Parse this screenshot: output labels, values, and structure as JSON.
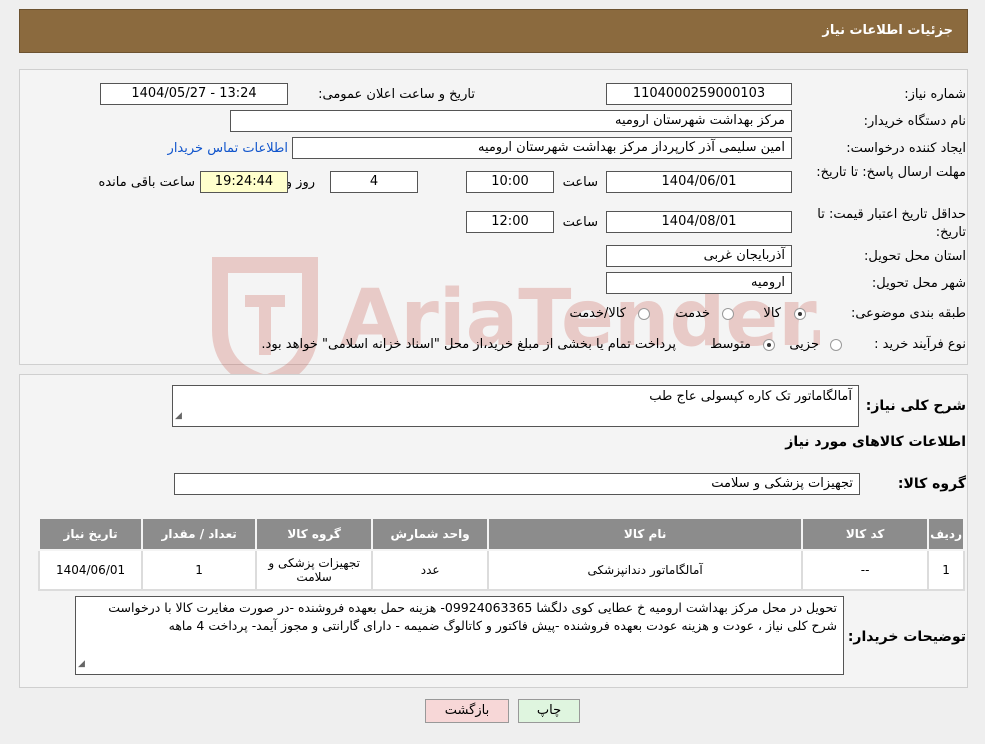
{
  "header": {
    "title": "جزئیات اطلاعات نیاز"
  },
  "watermark": {
    "text": "AriaTender.neT"
  },
  "form": {
    "need_number_label": "شماره نیاز:",
    "need_number": "1104000259000103",
    "announce_label": "تاریخ و ساعت اعلان عمومی:",
    "announce_value": "1404/05/27 - 13:24",
    "buyer_org_label": "نام دستگاه خریدار:",
    "buyer_org": "مرکز بهداشت شهرستان ارومیه",
    "creator_label": "ایجاد کننده درخواست:",
    "creator": "امین سلیمی آذر کارپرداز مرکز بهداشت شهرستان ارومیه",
    "contact_link": "اطلاعات تماس خریدار",
    "deadline_label": "مهلت ارسال پاسخ: تا تاریخ:",
    "deadline_date": "1404/06/01",
    "time_label": "ساعت",
    "deadline_time": "10:00",
    "days_value": "4",
    "days_label": "روز و",
    "remaining_time": "19:24:44",
    "remaining_label": "ساعت باقی مانده",
    "validity_label": "حداقل تاریخ اعتبار قیمت: تا تاریخ:",
    "validity_date": "1404/08/01",
    "validity_time": "12:00",
    "province_label": "استان محل تحویل:",
    "province": "آذربایجان غربی",
    "city_label": "شهر محل تحویل:",
    "city": "ارومیه",
    "category_label": "طبقه بندی موضوعی:",
    "category_options": [
      "کالا",
      "خدمت",
      "کالا/خدمت"
    ],
    "category_selected": 0,
    "purchase_label": "نوع فرآیند خرید :",
    "purchase_options": [
      "جزیی",
      "متوسط"
    ],
    "purchase_selected": 1,
    "purchase_note": "پرداخت تمام یا بخشی از مبلغ خرید،از محل \"اسناد خزانه اسلامی\" خواهد بود."
  },
  "details": {
    "summary_label": "شرح کلی نیاز:",
    "summary": "آمالگاماتور تک کاره کپسولی عاج طب",
    "goods_info_title": "اطلاعات کالاهای مورد نیاز",
    "goods_group_label": "گروه کالا:",
    "goods_group": "تجهیزات پزشکی و سلامت",
    "table": {
      "headers": [
        "ردیف",
        "کد کالا",
        "نام کالا",
        "واحد شمارش",
        "گروه کالا",
        "تعداد / مقدار",
        "تاریخ نیاز"
      ],
      "rows": [
        [
          "1",
          "--",
          "آمالگاماتور دندانپزشکی",
          "عدد",
          "تجهیزات پزشکی و سلامت",
          "1",
          "1404/06/01"
        ]
      ]
    },
    "buyer_notes_label": "توضیحات خریدار:",
    "buyer_notes": "تحویل در محل مرکز بهداشت ارومیه خ عطایی کوی دلگشا 09924063365- هزینه حمل بعهده فروشنده -در صورت مغایرت کالا با درخواست شرح کلی نیاز ، عودت و هزینه عودت بعهده فروشنده -پیش فاکتور و کاتالوگ ضمیمه -   دارای گارانتی و مجوز آیمد- پرداخت 4 ماهه"
  },
  "buttons": {
    "print": "چاپ",
    "back": "بازگشت"
  },
  "colors": {
    "header_bg": "#8b6a3e",
    "table_header_bg": "#8c8c8c",
    "back_button_bg": "#f7d7d7",
    "print_button_bg": "#dff5df"
  }
}
